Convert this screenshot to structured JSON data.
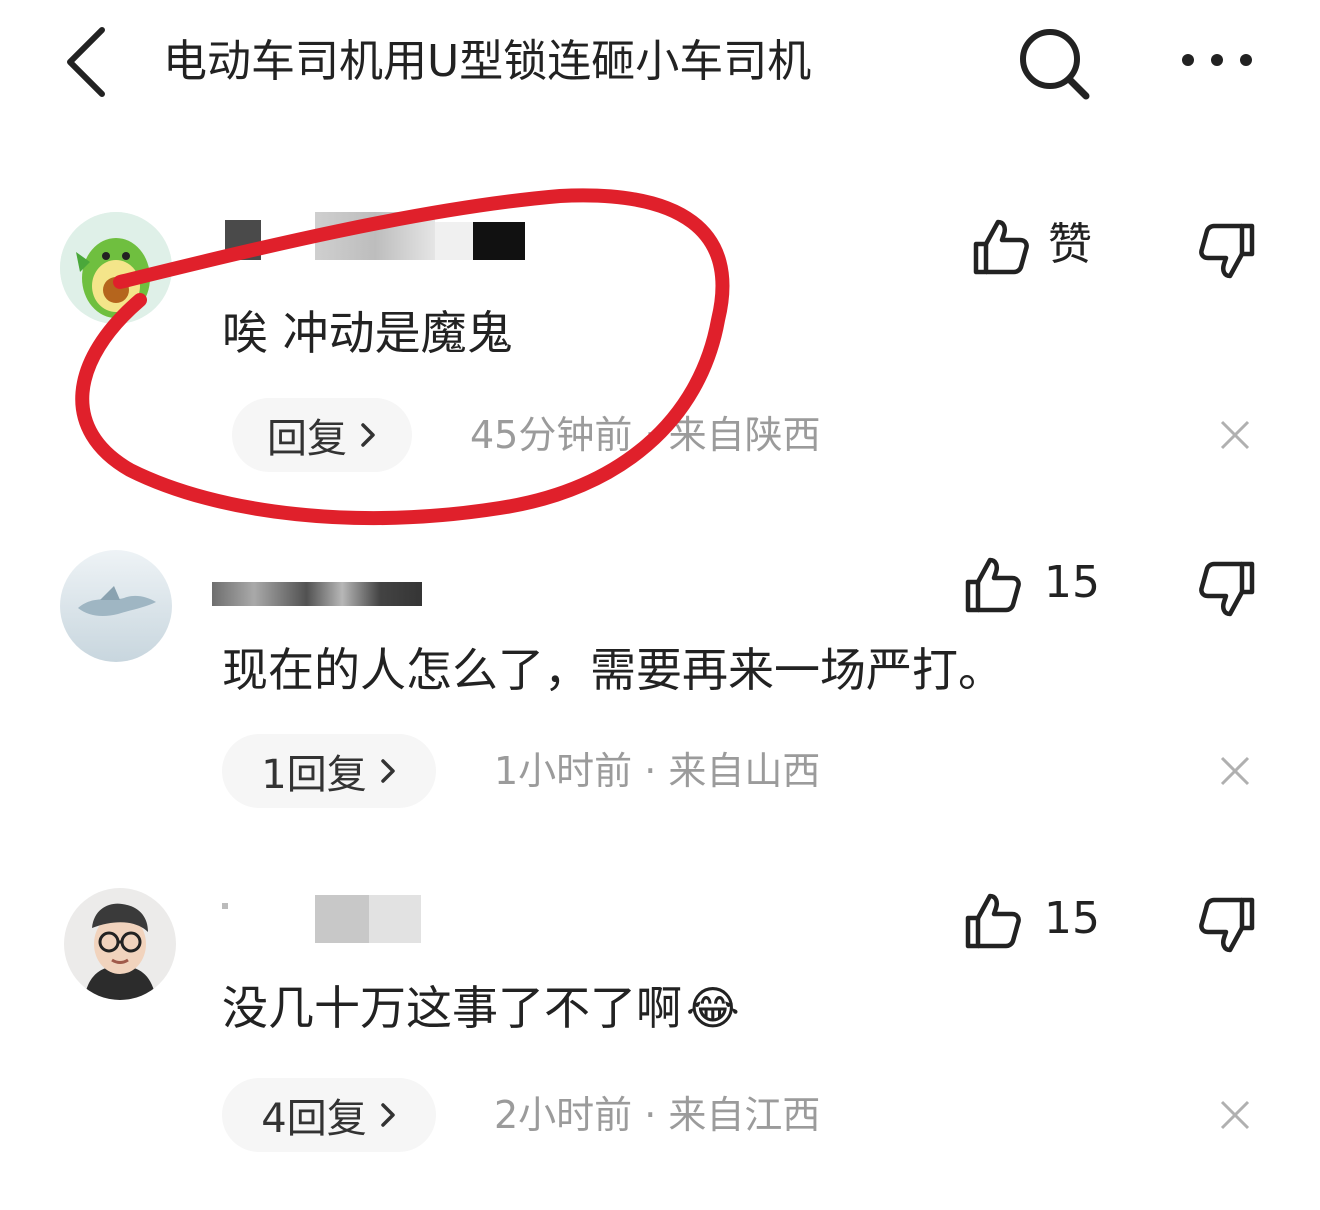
{
  "header": {
    "title": "电动车司机用U型锁连砸小车司机",
    "back_icon": "chevron-left-icon",
    "search_icon": "search-icon",
    "more_icon": "more-horizontal-icon"
  },
  "comments": [
    {
      "text": "唉 冲动是魔鬼",
      "like_label": "赞",
      "reply_label": "回复",
      "meta": "45分钟前 · 来自陕西",
      "highlighted": true,
      "highlight_color": "#e0202b"
    },
    {
      "text": "现在的人怎么了，需要再来一场严打。",
      "like_label": "15",
      "reply_label": "1回复",
      "meta": "1小时前 · 来自山西"
    },
    {
      "text": "没几十万这事了不了啊",
      "emoji": "😂",
      "like_label": "15",
      "reply_label": "4回复",
      "meta": "2小时前 · 来自江西"
    }
  ],
  "colors": {
    "text": "#222222",
    "meta": "#9b9b9b",
    "pill_bg": "#f6f6f6",
    "highlight": "#e0202b"
  }
}
